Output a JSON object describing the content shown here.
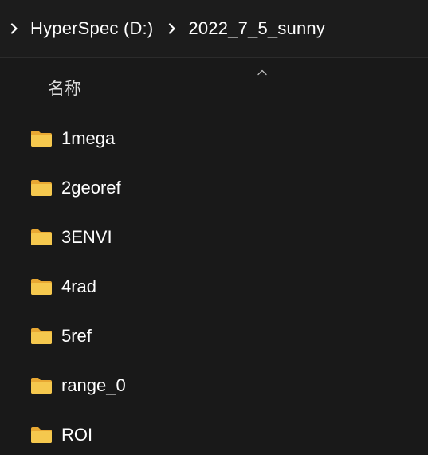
{
  "breadcrumb": {
    "items": [
      {
        "label": "HyperSpec (D:)"
      },
      {
        "label": "2022_7_5_sunny"
      }
    ]
  },
  "columns": {
    "name_header": "名称"
  },
  "files": [
    {
      "name": "1mega",
      "type": "folder"
    },
    {
      "name": "2georef",
      "type": "folder"
    },
    {
      "name": "3ENVI",
      "type": "folder"
    },
    {
      "name": "4rad",
      "type": "folder"
    },
    {
      "name": "5ref",
      "type": "folder"
    },
    {
      "name": "range_0",
      "type": "folder"
    },
    {
      "name": "ROI",
      "type": "folder"
    }
  ],
  "colors": {
    "background": "#191919",
    "folder": "#f2c14e",
    "text": "#ffffff"
  },
  "icons": {
    "separator": "chevron-right-icon",
    "sort": "chevron-up-icon",
    "item": "folder-icon"
  }
}
